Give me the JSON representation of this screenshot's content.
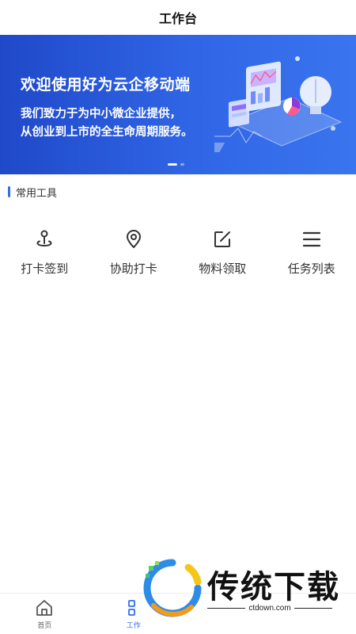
{
  "header": {
    "title": "工作台"
  },
  "banner": {
    "title": "欢迎使用好为云企移动端",
    "line1": "我们致力于为中小微企业提供，",
    "line2": "从创业到上市的全生命周期服务。",
    "slides": 2,
    "active_slide": 1
  },
  "section": {
    "title": "常用工具"
  },
  "tools": [
    {
      "label": "打卡签到",
      "icon": "location-pin-map-icon"
    },
    {
      "label": "协助打卡",
      "icon": "map-marker-icon"
    },
    {
      "label": "物料领取",
      "icon": "edit-icon"
    },
    {
      "label": "任务列表",
      "icon": "list-icon"
    }
  ],
  "tabbar": {
    "items": [
      {
        "label": "首页",
        "icon": "home-icon",
        "active": false
      },
      {
        "label": "工作",
        "icon": "grid-icon",
        "active": true
      }
    ]
  },
  "watermark": {
    "title": "传统下载",
    "site": "ctdown.com"
  },
  "colors": {
    "accent": "#2f6fe6",
    "banner_start": "#1f49c9",
    "banner_end": "#3a74ee"
  }
}
